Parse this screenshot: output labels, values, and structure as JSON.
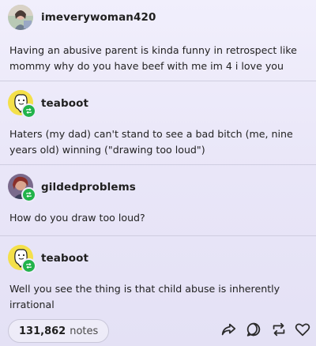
{
  "posts": [
    {
      "username": "imeverywoman420",
      "text": "Having an abusive parent is kinda funny in retrospect like mommy why do you have beef with me im 4 i love you",
      "avatar": "user-photo-avatar",
      "reblog": false
    },
    {
      "username": "teaboot",
      "text": "Haters (my dad) can't stand to see a bad bitch (me, nine years old) winning (\"drawing too loud\")",
      "avatar": "cartoon-face-avatar",
      "reblog": true
    },
    {
      "username": "gildedproblems",
      "text": "How do you draw too loud?",
      "avatar": "user-photo-avatar",
      "reblog": true
    },
    {
      "username": "teaboot",
      "text": "Well you see the thing is that child abuse is inherently irrational",
      "avatar": "cartoon-face-avatar",
      "reblog": true
    }
  ],
  "footer": {
    "notes_count": "131,862",
    "notes_label": "notes",
    "actions": [
      "share-icon",
      "reply-icon",
      "reblog-icon",
      "like-icon"
    ]
  },
  "colors": {
    "accent_green": "#22b34a",
    "background": "#ece9f8",
    "divider": "#cfcde0"
  }
}
